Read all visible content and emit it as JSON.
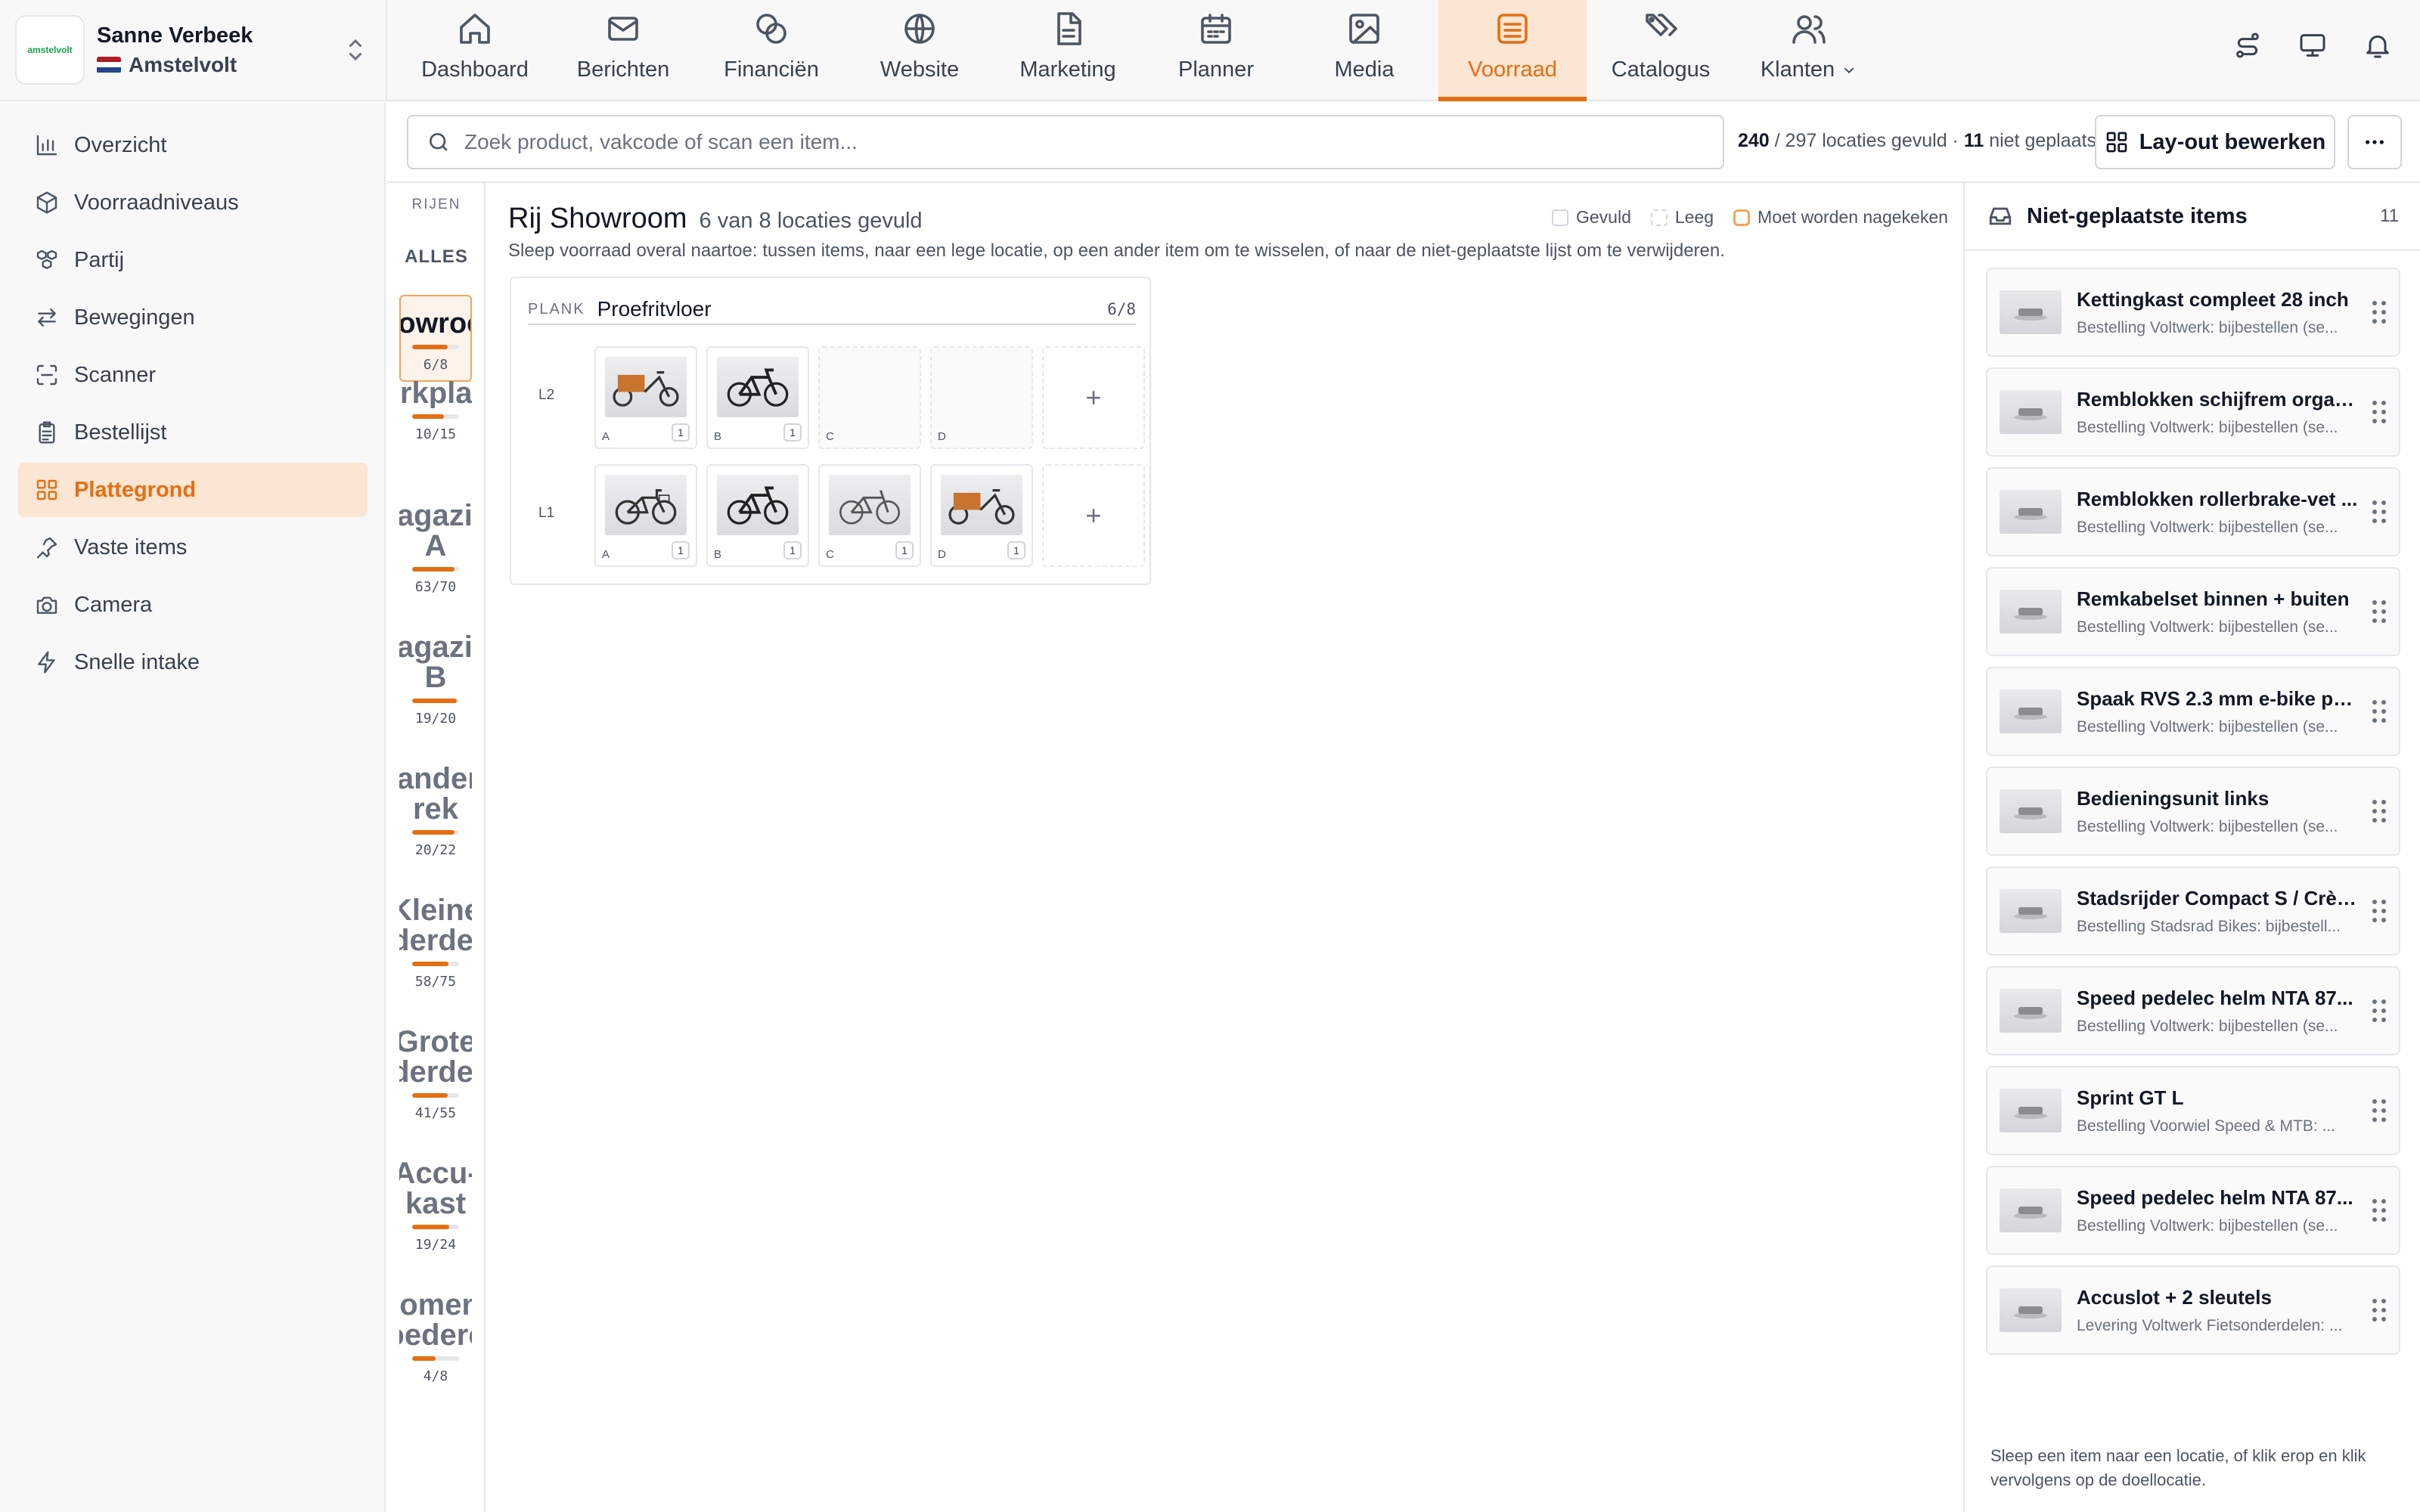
{
  "brand": {
    "logo_text": "amstelvolt",
    "user_name": "Sanne Verbeek",
    "location": "Amstelvolt",
    "flag_colors": [
      "#ae1c28",
      "#ffffff",
      "#21468b"
    ]
  },
  "nav": [
    {
      "label": "Dashboard",
      "icon": "home-icon"
    },
    {
      "label": "Berichten",
      "icon": "mail-icon"
    },
    {
      "label": "Financiën",
      "icon": "coins-icon"
    },
    {
      "label": "Website",
      "icon": "globe-icon"
    },
    {
      "label": "Marketing",
      "icon": "document-icon"
    },
    {
      "label": "Planner",
      "icon": "calendar-icon"
    },
    {
      "label": "Media",
      "icon": "image-icon"
    },
    {
      "label": "Voorraad",
      "icon": "warehouse-icon",
      "active": true
    },
    {
      "label": "Catalogus",
      "icon": "tags-icon"
    },
    {
      "label": "Klanten",
      "icon": "users-icon",
      "dropdown": true
    }
  ],
  "top_icons": [
    "route-icon",
    "monitor-icon",
    "bell-icon"
  ],
  "sidebar": [
    {
      "label": "Overzicht",
      "icon": "bar-chart-icon"
    },
    {
      "label": "Voorraadniveaus",
      "icon": "box-icon"
    },
    {
      "label": "Partij",
      "icon": "boxes-icon"
    },
    {
      "label": "Bewegingen",
      "icon": "arrows-icon"
    },
    {
      "label": "Scanner",
      "icon": "scan-icon"
    },
    {
      "label": "Bestellijst",
      "icon": "clipboard-icon"
    },
    {
      "label": "Plattegrond",
      "icon": "grid-icon",
      "active": true
    },
    {
      "label": "Vaste items",
      "icon": "pin-icon"
    },
    {
      "label": "Camera",
      "icon": "camera-icon"
    },
    {
      "label": "Snelle intake",
      "icon": "zap-icon"
    }
  ],
  "search": {
    "placeholder": "Zoek product, vakcode of scan een item..."
  },
  "stats": {
    "filled": "240",
    "filled_rest": " / 297 locaties gevuld · ",
    "unplaced": "11",
    "unplaced_rest": " niet geplaatst"
  },
  "actions": {
    "layout_label": "Lay-out bewerken",
    "more_label": "···"
  },
  "rows": {
    "header": "RIJEN",
    "all_label": "ALLES",
    "items": [
      {
        "name": [
          "Showroom"
        ],
        "count": "6/8",
        "fill": 0.75,
        "active": true
      },
      {
        "name": [
          "Werkplaats"
        ],
        "count": "10/15",
        "fill": 0.67
      },
      {
        "name": [
          "Magazijn",
          "A"
        ],
        "count": "63/70",
        "fill": 0.9
      },
      {
        "name": [
          "Magazijn",
          "B"
        ],
        "count": "19/20",
        "fill": 0.95
      },
      {
        "name": [
          "Banden-",
          "rek"
        ],
        "count": "20/22",
        "fill": 0.91
      },
      {
        "name": [
          "Kleine",
          "onderdelen"
        ],
        "count": "58/75",
        "fill": 0.77
      },
      {
        "name": [
          "Grote",
          "onderdelen"
        ],
        "count": "41/55",
        "fill": 0.75
      },
      {
        "name": [
          "Accu-",
          "kast"
        ],
        "count": "19/24",
        "fill": 0.79
      },
      {
        "name": [
          "Inkomende",
          "goederen"
        ],
        "count": "4/8",
        "fill": 0.5
      }
    ]
  },
  "main": {
    "title": "Rij Showroom",
    "subtitle": "6 van 8 locaties gevuld",
    "legend": {
      "filled": "Gevuld",
      "empty": "Leeg",
      "check": "Moet worden nagekeken"
    },
    "hint": "Sleep voorraad overal naartoe: tussen items, naar een lege locatie, op een ander item om te wisselen, of naar de niet-geplaatste lijst om te verwijderen."
  },
  "shelf": {
    "kind_label": "PLANK",
    "name": "Proefritvloer",
    "count": "6/8",
    "levels": [
      {
        "label": "L2",
        "slots": [
          {
            "pos": "A",
            "qty": "1",
            "filled": true,
            "icon": "cargo-bike-icon"
          },
          {
            "pos": "B",
            "qty": "1",
            "filled": true,
            "icon": "ebike-icon"
          },
          {
            "pos": "C",
            "filled": false
          },
          {
            "pos": "D",
            "filled": false
          }
        ]
      },
      {
        "label": "L1",
        "slots": [
          {
            "pos": "A",
            "qty": "1",
            "filled": true,
            "icon": "city-bike-icon"
          },
          {
            "pos": "B",
            "qty": "1",
            "filled": true,
            "icon": "ebike-icon"
          },
          {
            "pos": "C",
            "qty": "1",
            "filled": true,
            "icon": "road-bike-icon"
          },
          {
            "pos": "D",
            "qty": "1",
            "filled": true,
            "icon": "cargo-bike-icon"
          }
        ]
      }
    ],
    "add_label": "+"
  },
  "unplaced": {
    "title": "Niet-geplaatste items",
    "count": "11",
    "items": [
      {
        "title": "Kettingkast compleet 28 inch",
        "sub": "Bestelling Voltwerk: bijbestellen (se..."
      },
      {
        "title": "Remblokken schijfrem organ...",
        "sub": "Bestelling Voltwerk: bijbestellen (se..."
      },
      {
        "title": "Remblokken rollerbrake-vet ...",
        "sub": "Bestelling Voltwerk: bijbestellen (se..."
      },
      {
        "title": "Remkabelset binnen + buiten",
        "sub": "Bestelling Voltwerk: bijbestellen (se..."
      },
      {
        "title": "Spaak RVS 2.3 mm e-bike pe...",
        "sub": "Bestelling Voltwerk: bijbestellen (se..."
      },
      {
        "title": "Bedieningsunit links",
        "sub": "Bestelling Voltwerk: bijbestellen (se..."
      },
      {
        "title": "Stadsrijder Compact S / Crème",
        "sub": "Bestelling Stadsrad Bikes: bijbestell..."
      },
      {
        "title": "Speed pedelec helm NTA 87...",
        "sub": "Bestelling Voltwerk: bijbestellen (se..."
      },
      {
        "title": "Sprint GT L",
        "sub": "Bestelling Voorwiel Speed & MTB: ..."
      },
      {
        "title": "Speed pedelec helm NTA 87...",
        "sub": "Bestelling Voltwerk: bijbestellen (se..."
      },
      {
        "title": "Accuslot + 2 sleutels",
        "sub": "Levering Voltwerk Fietsonderdelen: ..."
      }
    ],
    "footer": "Sleep een item naar een locatie, of klik erop en klik vervolgens op de doellocatie."
  },
  "colors": {
    "accent": "#e36f12",
    "accent_bg": "#fbe5d3"
  }
}
